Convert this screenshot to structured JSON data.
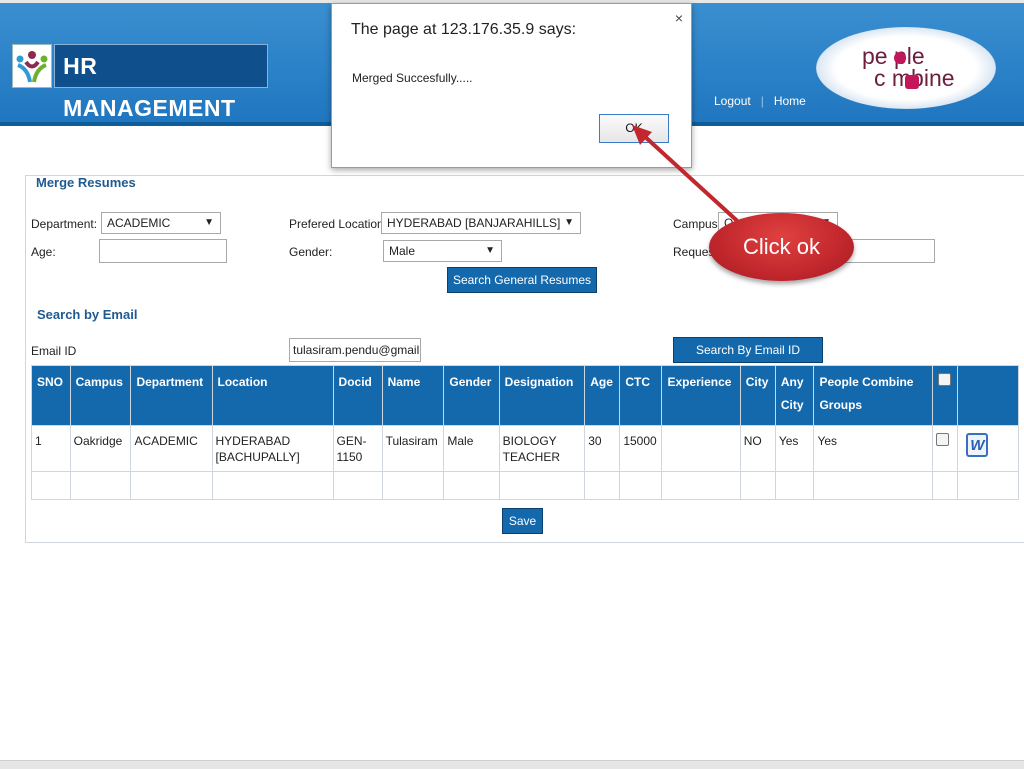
{
  "header": {
    "title": "HR MANAGEMENT",
    "logo_icon": "people-figures-logo",
    "brand_logo_line1": "pe ple",
    "brand_logo_line2": "c mbine",
    "links": [
      "Logout",
      "Home"
    ]
  },
  "dialog": {
    "title": "The page at 123.176.35.9 says:",
    "message": "Merged Succesfully.....",
    "ok_label": "OK",
    "close_glyph": "×"
  },
  "annotation": {
    "text": "Click ok"
  },
  "merge": {
    "section_title": "Merge Resumes",
    "department_label": "Department:",
    "department_value": "ACADEMIC",
    "location_label": "Prefered Location:",
    "location_value": "HYDERABAD [BANJARAHILLS]",
    "campus_label": "Campus:",
    "campus_value": "O",
    "age_label": "Age:",
    "age_value": "",
    "gender_label": "Gender:",
    "gender_value": "Male",
    "request_label": "Reques",
    "search_button": "Search General Resumes"
  },
  "email_search": {
    "section_title": "Search by Email",
    "email_label": "Email ID",
    "email_value": "tulasiram.pendu@gmail.cc",
    "search_button": "Search By Email ID"
  },
  "table": {
    "headers": [
      "SNO",
      "Campus",
      "Department",
      "Location",
      "Docid",
      "Name",
      "Gender",
      "Designation",
      "Age",
      "CTC",
      "Experience",
      "City",
      "Any City",
      "People Combine Groups"
    ],
    "rows": [
      {
        "sno": "1",
        "campus": "Oakridge",
        "department": "ACADEMIC",
        "location": "HYDERABAD [BACHUPALLY]",
        "docid": "GEN-1150",
        "name": "Tulasiram",
        "gender": "Male",
        "designation": "BIOLOGY TEACHER",
        "age": "30",
        "ctc": "15000",
        "experience": "",
        "city": "NO",
        "any_city": "Yes",
        "groups": "Yes",
        "doc_icon": "word-document-icon"
      }
    ]
  },
  "save_button": "Save",
  "colors": {
    "header_blue": "#1f76bf",
    "table_header": "#1469ad",
    "section_title": "#1f5a92",
    "annotation_red": "#c1272d"
  }
}
